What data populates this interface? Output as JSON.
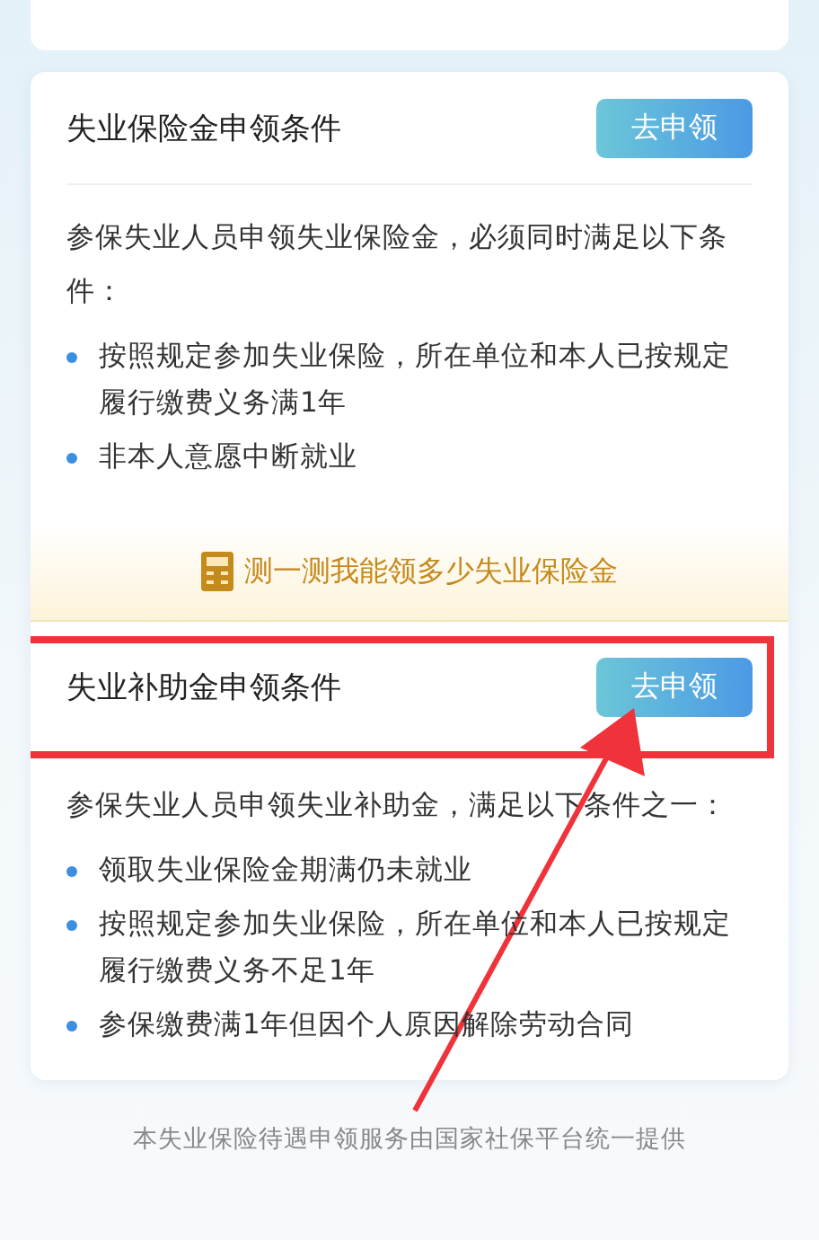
{
  "sections": [
    {
      "title": "失业保险金申领条件",
      "button": "去申领",
      "highlighted": false,
      "intro": "参保失业人员申领失业保险金，必须同时满足以下条件：",
      "conditions": [
        "按照规定参加失业保险，所在单位和本人已按规定履行缴费义务满1年",
        "非本人意愿中断就业"
      ],
      "calculator_link": "测一测我能领多少失业保险金"
    },
    {
      "title": "失业补助金申领条件",
      "button": "去申领",
      "highlighted": true,
      "intro": "参保失业人员申领失业补助金，满足以下条件之一：",
      "conditions": [
        "领取失业保险金期满仍未就业",
        "按照规定参加失业保险，所在单位和本人已按规定履行缴费义务不足1年",
        "参保缴费满1年但因个人原因解除劳动合同"
      ]
    }
  ],
  "footer": "本失业保险待遇申领服务由国家社保平台统一提供"
}
